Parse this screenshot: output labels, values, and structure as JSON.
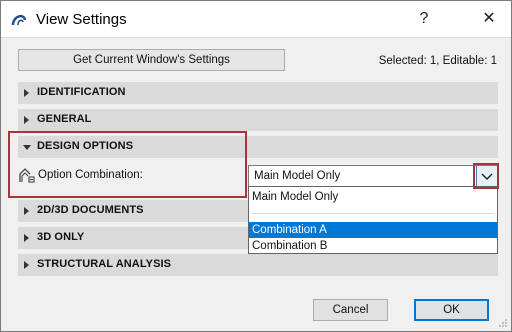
{
  "window": {
    "title": "View Settings",
    "help_label": "?",
    "close_label": "✕"
  },
  "toolbar": {
    "get_settings_label": "Get Current Window's Settings",
    "selection_info": "Selected: 1, Editable: 1"
  },
  "sections": {
    "identification": "IDENTIFICATION",
    "general": "GENERAL",
    "design_options": "DESIGN OPTIONS",
    "documents_2d3d": "2D/3D DOCUMENTS",
    "only_3d": "3D ONLY",
    "structural_analysis": "STRUCTURAL ANALYSIS"
  },
  "design_options": {
    "field_label": "Option Combination:",
    "selected_value": "Main Model Only",
    "options": [
      "Main Model Only",
      "Combination A",
      "Combination B"
    ],
    "highlighted_option": "Combination A"
  },
  "footer": {
    "cancel_label": "Cancel",
    "ok_label": "OK"
  },
  "icons": {
    "app": "archicad-icon",
    "option": "design-option-icon",
    "dropdown": "chevron-down-icon"
  },
  "colors": {
    "highlight": "#a4373a",
    "selection": "#0078d7",
    "section_bg": "#dadada"
  }
}
